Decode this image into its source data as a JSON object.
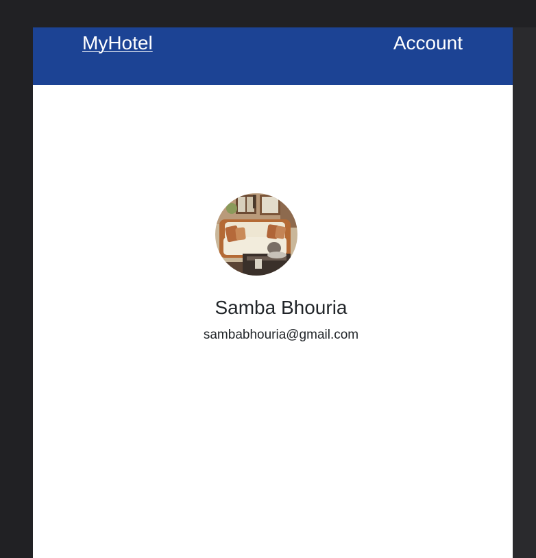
{
  "navbar": {
    "brand": "MyHotel",
    "account_label": "Account"
  },
  "profile": {
    "avatar": "sofa-room-photo",
    "name": "Samba Bhouria",
    "email": "sambabhouria@gmail.com"
  },
  "colors": {
    "navbar_bg": "#1c4394",
    "page_bg": "#ffffff",
    "outer_bg": "#212124",
    "text": "#212529"
  }
}
